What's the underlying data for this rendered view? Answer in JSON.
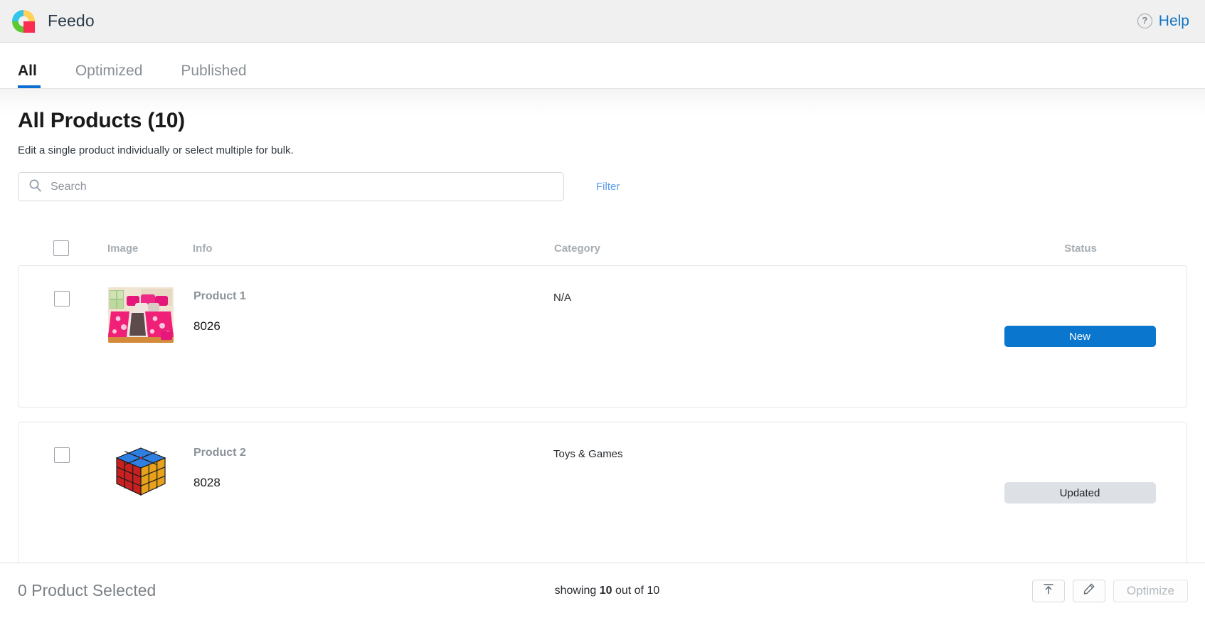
{
  "header": {
    "brand_name": "Feedo",
    "logo_colors": {
      "top_left": "#31c5ea",
      "top_right": "#ffd257",
      "bottom_left": "#5cc832",
      "bottom_right": "#f92d4f"
    },
    "help_label": "Help",
    "help_icon": "question-circle-icon"
  },
  "tabs": [
    {
      "label": "All",
      "active": true
    },
    {
      "label": "Optimized",
      "active": false
    },
    {
      "label": "Published",
      "active": false
    }
  ],
  "page": {
    "title": "All Products (10)",
    "subtitle": "Edit a single product individually or select multiple for bulk."
  },
  "search": {
    "placeholder": "Search",
    "value": "",
    "icon": "search-icon",
    "filter_label": "Filter"
  },
  "table": {
    "columns": {
      "image": "Image",
      "info": "Info",
      "category": "Category",
      "status": "Status"
    },
    "rows": [
      {
        "name": "Product 1",
        "id": "8026",
        "category": "N/A",
        "status": "New",
        "status_variant": "new",
        "thumb": "pink-bedding-set-photo"
      },
      {
        "name": "Product 2",
        "id": "8028",
        "category": "Toys & Games",
        "status": "Updated",
        "status_variant": "updated",
        "thumb": "rubiks-cube-photo"
      }
    ]
  },
  "footer": {
    "selected_count": "0",
    "selected_label": "0 Product Selected",
    "showing_prefix": "showing ",
    "showing_count": "10",
    "showing_suffix": " out of 10",
    "export_icon": "export-to-top-icon",
    "edit_icon": "pencil-icon",
    "optimize_label": "Optimize"
  },
  "colors": {
    "accent_blue": "#0a76cd",
    "link_blue": "#1275c4",
    "tab_underline": "#0b6fd4",
    "badge_gray": "#dde1e6"
  }
}
